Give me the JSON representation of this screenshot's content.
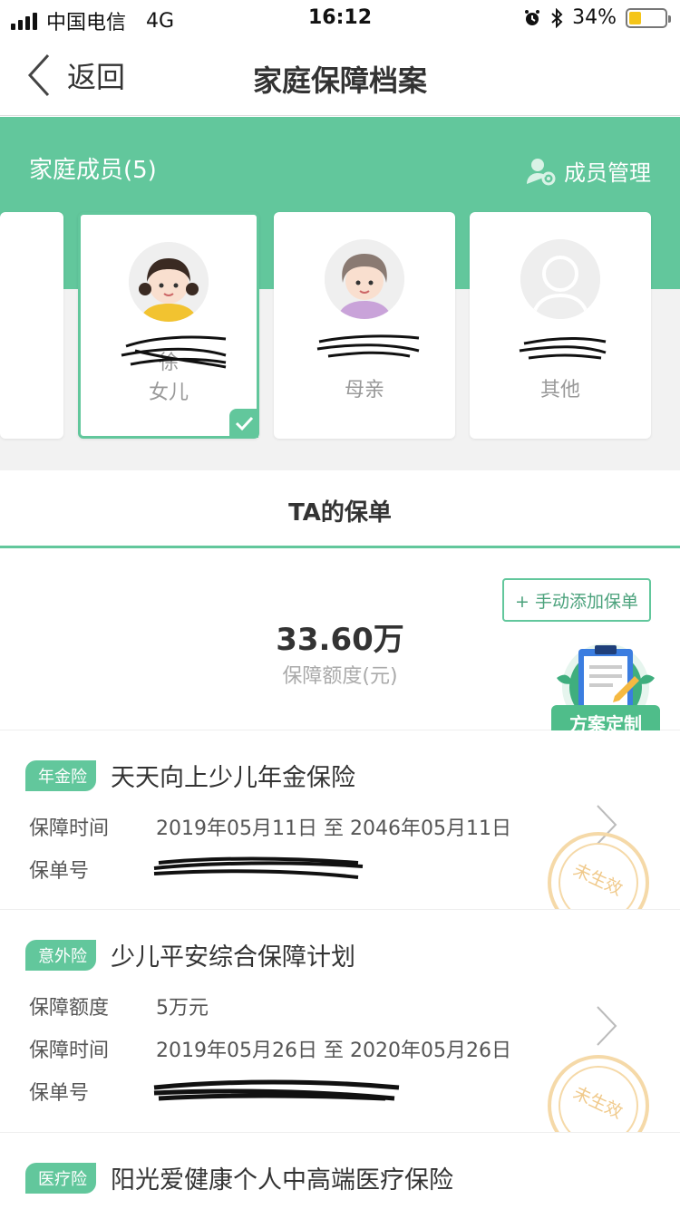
{
  "status_bar": {
    "carrier": "中国电信",
    "network": "4G",
    "time": "16:12",
    "battery": "34%",
    "battery_level": 0.34,
    "icons": [
      "alarm-icon",
      "bluetooth-icon"
    ]
  },
  "nav": {
    "back_label": "返回",
    "title": "家庭保障档案"
  },
  "family": {
    "title": "家庭成员(5)",
    "manage_label": "成员管理",
    "members": [
      {
        "name": "徐",
        "relation": "女儿",
        "selected": true
      },
      {
        "name": "",
        "relation": "母亲",
        "selected": false
      },
      {
        "name": "",
        "relation": "其他",
        "selected": false
      }
    ]
  },
  "tab": {
    "label": "TA的保单"
  },
  "summary": {
    "add_button": "+ 手动添加保单",
    "amount": "33.60万",
    "amount_label": "保障额度(元)",
    "plan_label": "方案定制"
  },
  "policies": [
    {
      "tag": "年金险",
      "name": "天天向上少儿年金保险",
      "rows": [
        {
          "key": "保障时间",
          "value": "2019年05月11日 至 2046年05月11日"
        },
        {
          "key": "保单号",
          "value": ""
        }
      ],
      "stamp": "未生效"
    },
    {
      "tag": "意外险",
      "name": "少儿平安综合保障计划",
      "rows": [
        {
          "key": "保障额度",
          "value": "5万元"
        },
        {
          "key": "保障时间",
          "value": "2019年05月26日 至 2020年05月26日"
        },
        {
          "key": "保单号",
          "value": ""
        }
      ],
      "stamp": "未生效"
    },
    {
      "tag": "医疗险",
      "name": "阳光爱健康个人中高端医疗保险"
    }
  ],
  "colors": {
    "accent": "#62c79c",
    "stamp": "#f0c98a"
  }
}
